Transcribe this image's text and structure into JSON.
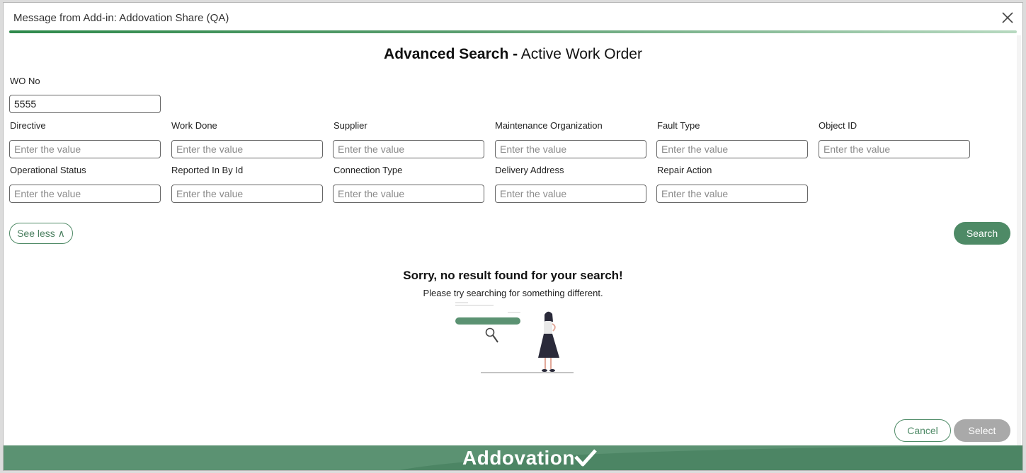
{
  "dialog": {
    "title": "Message from Add-in: Addovation Share (QA)",
    "close_icon": "close-icon"
  },
  "heading": {
    "bold": "Advanced Search -",
    "rest": "Active Work Order"
  },
  "fields": {
    "wo_no": {
      "label": "WO No",
      "value": "5555"
    },
    "directive": {
      "label": "Directive",
      "placeholder": "Enter the value"
    },
    "work_done": {
      "label": "Work Done",
      "placeholder": "Enter the value"
    },
    "supplier": {
      "label": "Supplier",
      "placeholder": "Enter the value"
    },
    "maintenance_org": {
      "label": "Maintenance Organization",
      "placeholder": "Enter the value"
    },
    "fault_type": {
      "label": "Fault Type",
      "placeholder": "Enter the value"
    },
    "object_id": {
      "label": "Object ID",
      "placeholder": "Enter the value"
    },
    "operational_status": {
      "label": "Operational Status",
      "placeholder": "Enter the value"
    },
    "reported_in_by_id": {
      "label": "Reported In By Id",
      "placeholder": "Enter the value"
    },
    "connection_type": {
      "label": "Connection Type",
      "placeholder": "Enter the value"
    },
    "delivery_address": {
      "label": "Delivery Address",
      "placeholder": "Enter the value"
    },
    "repair_action": {
      "label": "Repair Action",
      "placeholder": "Enter the value"
    }
  },
  "buttons": {
    "see_less": "See less ∧",
    "search": "Search",
    "cancel": "Cancel",
    "select": "Select"
  },
  "empty_state": {
    "title": "Sorry, no result found for your search!",
    "subtitle": "Please try searching for something different."
  },
  "footer": {
    "brand": "Addovation"
  },
  "colors": {
    "accent": "#4e8a66",
    "footer": "#5b9272",
    "disabled": "#a9a9a9"
  }
}
